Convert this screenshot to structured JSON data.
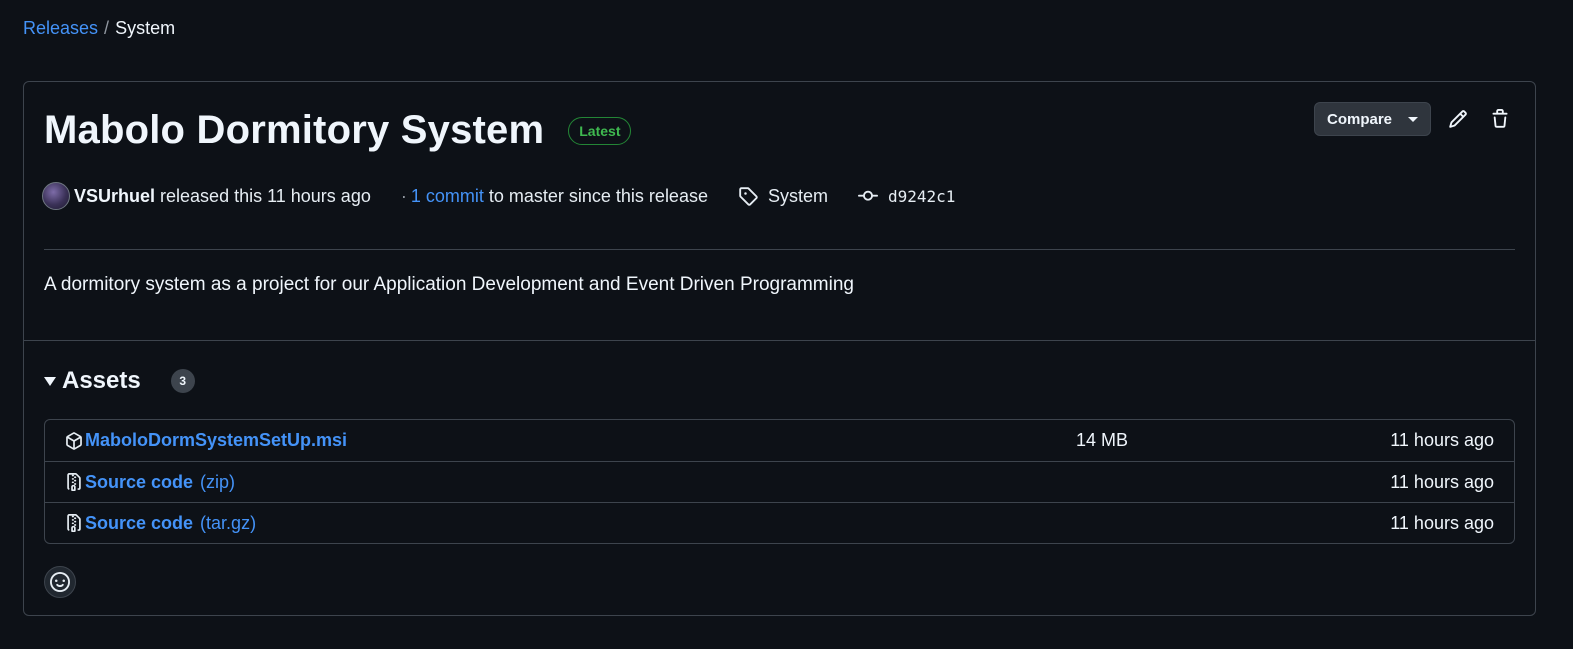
{
  "breadcrumb": {
    "parent": "Releases",
    "separator": "/",
    "current": "System"
  },
  "release": {
    "title": "Mabolo Dormitory System",
    "badge": "Latest",
    "compare_label": "Compare",
    "author": "VSUrhuel",
    "released_text": "released this 11 hours ago",
    "dot": "·",
    "commit_link": "1 commit",
    "commit_suffix": "to master since this release",
    "tag": "System",
    "commit_hash": "d9242c1",
    "description": "A dormitory system as a project for our Application Development and Event Driven Programming"
  },
  "assets": {
    "title": "Assets",
    "count": "3",
    "rows": [
      {
        "icon": "package-icon",
        "name": "MaboloDormSystemSetUp.msi",
        "suffix": "",
        "size": "14 MB",
        "time": "11 hours ago"
      },
      {
        "icon": "file-zip-icon",
        "name": "Source code",
        "suffix": "(zip)",
        "size": "",
        "time": "11 hours ago"
      },
      {
        "icon": "file-zip-icon",
        "name": "Source code",
        "suffix": "(tar.gz)",
        "size": "",
        "time": "11 hours ago"
      }
    ]
  },
  "colors": {
    "background": "#0d1117",
    "link": "#4493f8",
    "latest_green": "#3fb950",
    "border": "#3d444d"
  }
}
